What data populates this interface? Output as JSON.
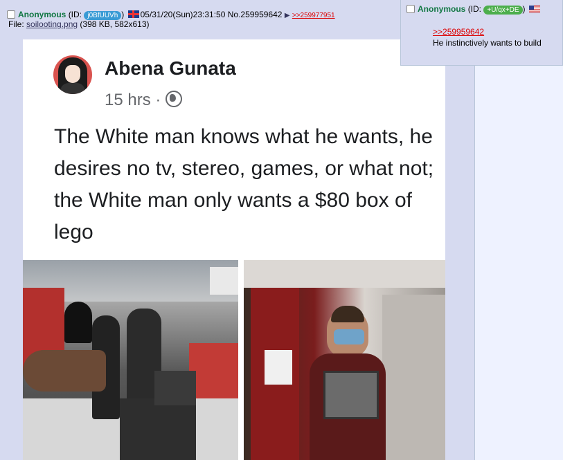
{
  "op_post": {
    "name": "Anonymous",
    "id_prefix": "(ID:",
    "id_value": "j0BfUUVh",
    "id_suffix": ")",
    "id_color": "#3a9bd5",
    "datetime": "05/31/20(Sun)23:31:50",
    "post_no": "No.259959642",
    "reply_link": ">>259977951",
    "file_label": "File:",
    "file_name": "soilooting.png",
    "file_meta": "(398 KB, 582x613)"
  },
  "screenshot": {
    "author": "Abena Gunata",
    "time": "15 hrs",
    "dot": "·",
    "post_text": "The White man knows what he wants, he desires no tv, stereo, games, or what not; the White man only wants a $80 box of lego"
  },
  "reply_post": {
    "name": "Anonymous",
    "id_prefix": "(ID:",
    "id_value": "+U/qx+DE",
    "id_suffix": ")",
    "id_color": "#4cae4c",
    "quote_link": ">>259959642",
    "text": "He instinctively wants to build"
  }
}
